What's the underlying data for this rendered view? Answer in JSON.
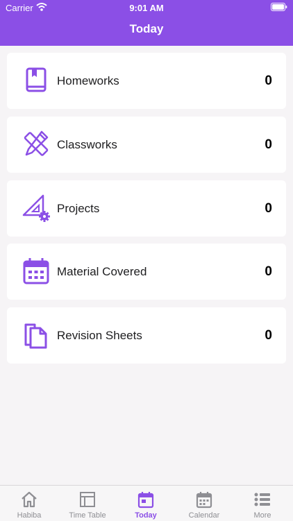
{
  "status_bar": {
    "carrier": "Carrier",
    "time": "9:01 AM"
  },
  "header": {
    "title": "Today"
  },
  "cards": [
    {
      "label": "Homeworks",
      "count": "0",
      "icon": "book-icon"
    },
    {
      "label": "Classworks",
      "count": "0",
      "icon": "ruler-pencil-icon"
    },
    {
      "label": "Projects",
      "count": "0",
      "icon": "triangle-gear-icon"
    },
    {
      "label": "Material Covered",
      "count": "0",
      "icon": "calendar-icon"
    },
    {
      "label": "Revision Sheets",
      "count": "0",
      "icon": "copy-document-icon"
    }
  ],
  "tabs": [
    {
      "label": "Habiba",
      "icon": "home-icon",
      "active": false
    },
    {
      "label": "Time Table",
      "icon": "table-icon",
      "active": false
    },
    {
      "label": "Today",
      "icon": "calendar-day-icon",
      "active": true
    },
    {
      "label": "Calendar",
      "icon": "calendar-icon",
      "active": false
    },
    {
      "label": "More",
      "icon": "list-icon",
      "active": false
    }
  ],
  "colors": {
    "accent": "#8b4fe6",
    "inactive": "#8e8e93",
    "background": "#f6f4f6"
  }
}
